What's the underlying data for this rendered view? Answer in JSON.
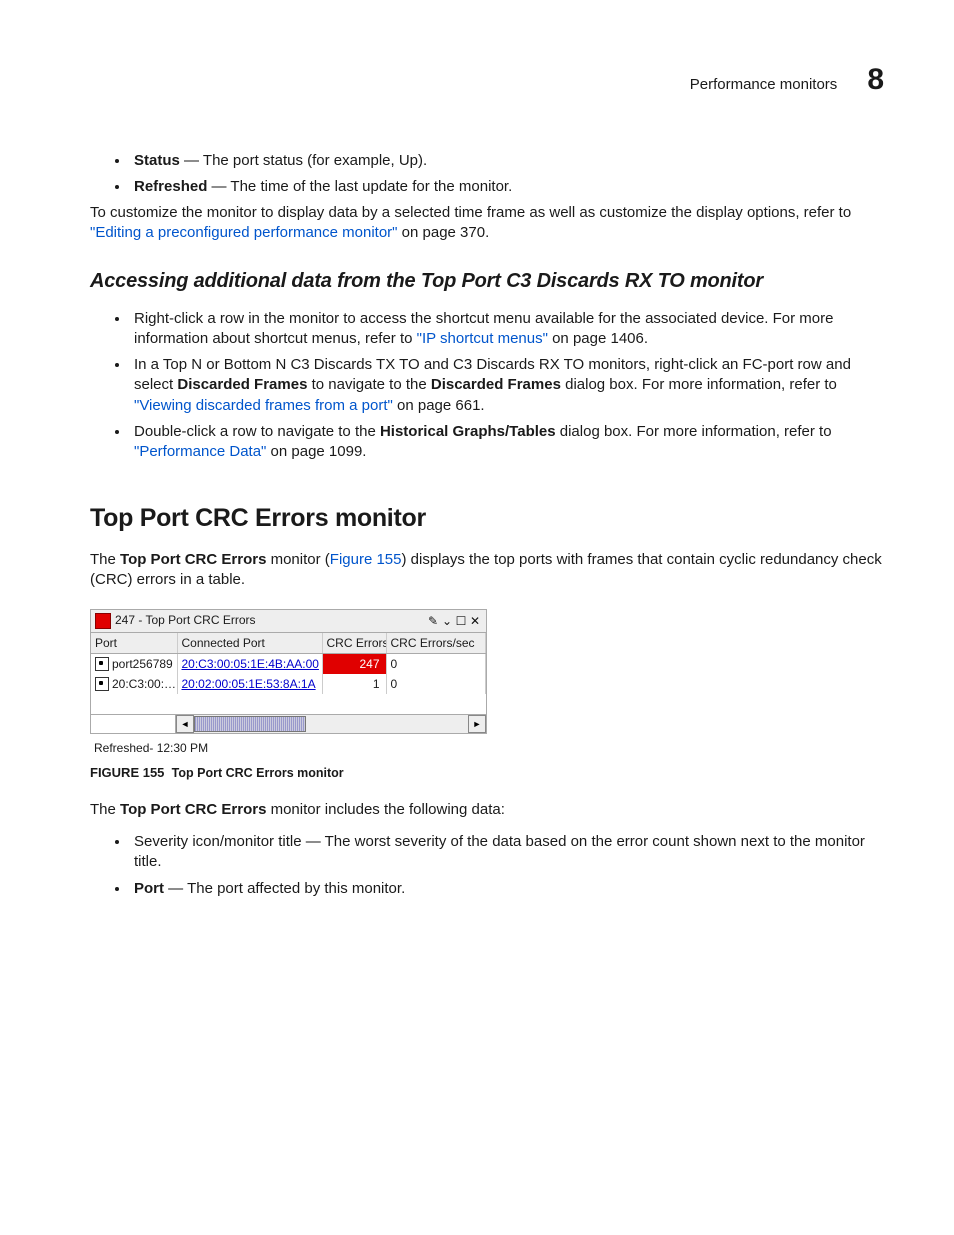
{
  "header": {
    "section": "Performance monitors",
    "chapter": "8"
  },
  "intro_bullets": [
    {
      "label": "Status",
      "desc": " — The port status (for example, Up)."
    },
    {
      "label": "Refreshed",
      "desc": " — The time of the last update for the monitor."
    }
  ],
  "customize": {
    "pre": "To customize the monitor to display data by a selected time frame as well as customize the display options, refer to ",
    "link": "\"Editing a preconfigured performance monitor\"",
    "post": " on page 370."
  },
  "sub_heading": "Accessing additional data from the Top Port C3 Discards RX TO monitor",
  "access_bullets": {
    "b1": {
      "pre": "Right-click a row in the monitor to access the shortcut menu available for the associated device. For more information about shortcut menus, refer to ",
      "link": "\"IP shortcut menus\"",
      "post": " on page 1406."
    },
    "b2": {
      "pre": "In a Top N or Bottom N C3 Discards TX TO and C3 Discards RX TO monitors, right-click an FC-port row and select ",
      "bold1": "Discarded Frames",
      "mid": " to navigate to the ",
      "bold2": "Discarded Frames",
      "mid2": " dialog box. For more information, refer to ",
      "link": "\"Viewing discarded frames from a port\"",
      "post": " on page 661."
    },
    "b3": {
      "pre": "Double-click a row to navigate to the ",
      "bold1": "Historical Graphs/Tables",
      "mid": " dialog box. For more information, refer to ",
      "link": "\"Performance Data\"",
      "post": " on page 1099."
    }
  },
  "section_heading": "Top Port CRC Errors monitor",
  "sec_intro": {
    "pre": "The ",
    "bold": "Top Port CRC Errors",
    "mid": " monitor (",
    "link": "Figure 155",
    "post": ") displays the top ports with frames that contain cyclic redundancy check (CRC) errors in a table."
  },
  "monitor": {
    "title": "247 - Top Port CRC Errors",
    "columns": [
      "Port",
      "Connected Port",
      "CRC Errors",
      "CRC Errors/sec"
    ],
    "rows": [
      {
        "port": "port256789",
        "connected": "20:C3:00:05:1E:4B:AA:00",
        "crc": "247",
        "crc_bad": true,
        "rate": "0"
      },
      {
        "port": "20:C3:00:…",
        "connected": "20:02:00:05:1E:53:8A:1A",
        "crc": "1",
        "crc_bad": false,
        "rate": "0"
      }
    ],
    "refreshed": "Refreshed- 12:30 PM"
  },
  "figure": {
    "num": "FIGURE 155",
    "caption": "Top Port CRC Errors monitor"
  },
  "includes": {
    "pre": "The ",
    "bold": "Top Port CRC Errors",
    "post": " monitor includes the following data:"
  },
  "data_bullets": [
    {
      "text": "Severity icon/monitor title — The worst severity of the data based on the error count shown next to the monitor title."
    },
    {
      "label": "Port",
      "desc": " — The port affected by this monitor."
    }
  ]
}
